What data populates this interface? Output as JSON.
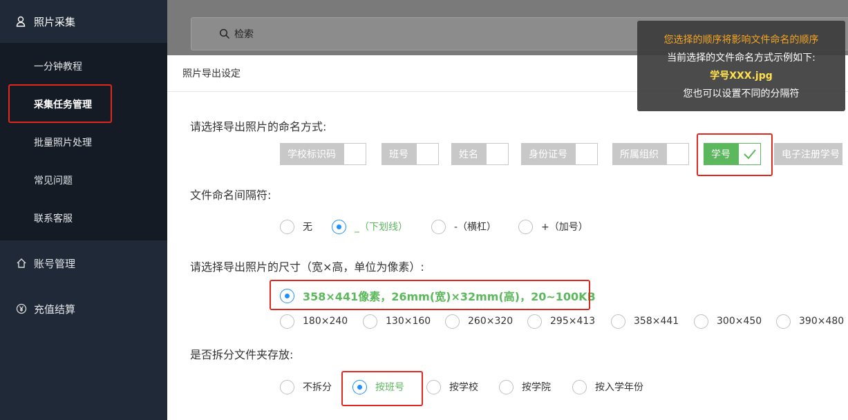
{
  "sidebar": {
    "top": {
      "label": "照片采集",
      "icon": "user-icon"
    },
    "subitems": [
      {
        "label": "一分钟教程"
      },
      {
        "label": "采集任务管理"
      },
      {
        "label": "批量照片处理"
      },
      {
        "label": "常见问题"
      },
      {
        "label": "联系客服"
      }
    ],
    "items": [
      {
        "label": "账号管理",
        "icon": "home-icon"
      },
      {
        "label": "充值结算",
        "icon": "yen-icon"
      }
    ]
  },
  "search": {
    "label": "检索"
  },
  "modal": {
    "title": "照片导出设定",
    "naming": {
      "question": "请选择导出照片的命名方式:",
      "tags": [
        "学校标识码",
        "班号",
        "姓名",
        "身份证号",
        "所属组织",
        "学号",
        "电子注册学号"
      ],
      "selected": "学号"
    },
    "separator": {
      "question": "文件命名间隔符:",
      "options": [
        "无",
        "_（下划线）",
        "-（横杠）",
        "+（加号）"
      ],
      "selected": "_（下划线）"
    },
    "size": {
      "question": "请选择导出照片的尺寸（宽×高，单位为像素）:",
      "recommended": "358×441像素，26mm(宽)×32mm(高)，20~100KB",
      "options": [
        "180×240",
        "130×160",
        "260×320",
        "295×413",
        "358×441",
        "300×450",
        "390×480"
      ]
    },
    "split": {
      "question": "是否拆分文件夹存放:",
      "options": [
        "不拆分",
        "按班号",
        "按学校",
        "按学院",
        "按入学年份"
      ],
      "selected": "按班号"
    }
  },
  "tooltip": {
    "line1": "您选择的顺序将影响文件命名的顺序",
    "line2": "当前选择的文件命名方式示例如下:",
    "line3": "学号XXX.jpg",
    "line4": "您也可以设置不同的分隔符"
  },
  "colors": {
    "sidebar": "#1f2937",
    "accent_green": "#5cb85c",
    "radio_blue": "#1e90ff",
    "highlight_red": "#e0281f"
  }
}
